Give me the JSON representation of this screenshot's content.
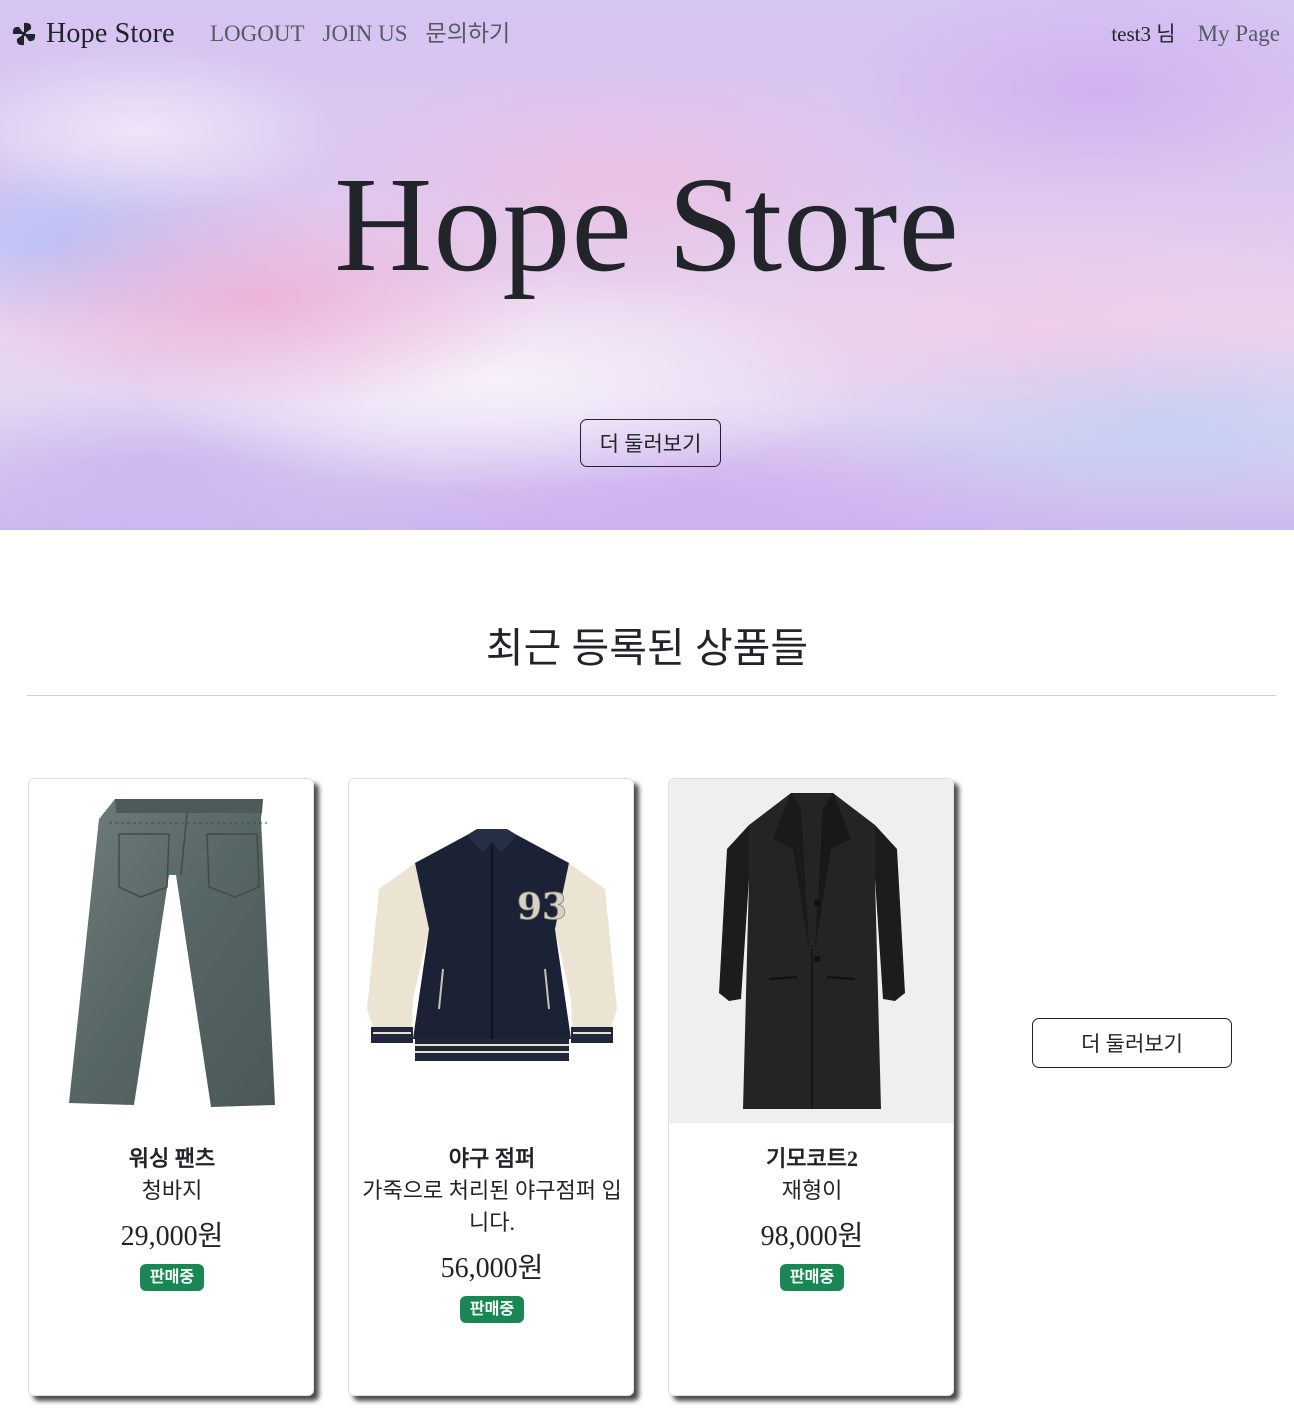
{
  "navbar": {
    "brand": "Hope Store",
    "brand_icon": "pinwheel-icon",
    "links": [
      "LOGOUT",
      "JOIN US",
      "문의하기"
    ],
    "user_label": "test3 님",
    "mypage": "My Page"
  },
  "hero": {
    "title": "Hope Store",
    "button": "더 둘러보기"
  },
  "recent": {
    "title": "최근 등록된 상품들",
    "more_button": "더 둘러보기",
    "products": [
      {
        "name": "워싱 팬츠",
        "description": "청바지",
        "price": "29,000원",
        "status": "판매중",
        "image": "jeans-image"
      },
      {
        "name": "야구 점퍼",
        "description": "가죽으로 처리된 야구점퍼 입니다.",
        "price": "56,000원",
        "status": "판매중",
        "image": "varsity-jacket-image"
      },
      {
        "name": "기모코트2",
        "description": "재형이",
        "price": "98,000원",
        "status": "판매중",
        "image": "black-coat-image"
      }
    ]
  },
  "colors": {
    "badge": "#198754",
    "text": "#212529",
    "nav_link": "#555a63"
  }
}
